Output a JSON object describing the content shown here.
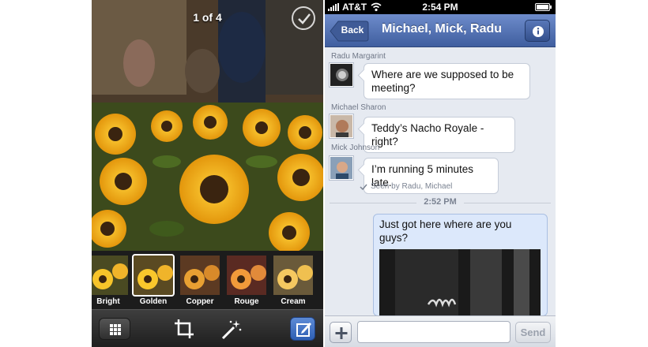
{
  "photo_editor": {
    "counter": "1 of 4",
    "filters": [
      {
        "label": "Bright",
        "selected": false
      },
      {
        "label": "Golden",
        "selected": true
      },
      {
        "label": "Copper",
        "selected": false
      },
      {
        "label": "Rouge",
        "selected": false
      },
      {
        "label": "Cream",
        "selected": false
      }
    ],
    "toolbar": {
      "grid_icon": "grid-icon",
      "crop_icon": "crop-icon",
      "wand_icon": "magic-wand-icon",
      "edit_icon": "compose-icon"
    }
  },
  "messenger": {
    "status_bar": {
      "carrier": "AT&T",
      "time": "2:54 PM"
    },
    "nav": {
      "back_label": "Back",
      "title": "Michael, Mick, Radu"
    },
    "messages": [
      {
        "sender": "Radu Margarint",
        "text": "Where are we supposed to be meeting?"
      },
      {
        "sender": "Michael Sharon",
        "text": "Teddy’s Nacho Royale - right?"
      },
      {
        "sender": "Mick Johnson",
        "text": "I’m running 5 minutes late."
      }
    ],
    "seen_text": "Seen by Radu, Michael",
    "time_divider": "2:52 PM",
    "outgoing": {
      "text": "Just got here where are you guys?"
    },
    "composer": {
      "placeholder": "",
      "send_label": "Send"
    }
  },
  "colors": {
    "nav_blue": "#4a68a8",
    "outgoing_bubble": "#dce8fb",
    "background": "#e6eaf1"
  }
}
